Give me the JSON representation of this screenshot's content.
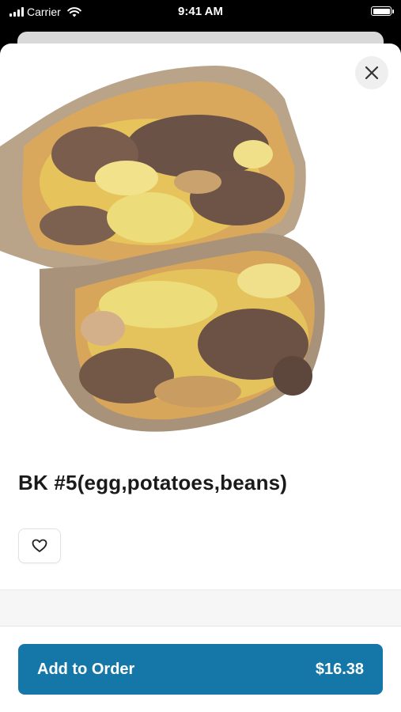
{
  "status_bar": {
    "carrier": "Carrier",
    "time": "9:41 AM"
  },
  "item": {
    "title": "BK #5(egg,potatoes,beans)",
    "image_alt": "Breakfast burrito cut in half showing egg, potatoes and beans"
  },
  "actions": {
    "close_icon": "close-icon",
    "favorite_icon": "heart-icon",
    "add_to_order_label": "Add to Order",
    "price": "$16.38"
  },
  "colors": {
    "accent": "#1577a8",
    "background": "#ffffff",
    "status_bar": "#000000"
  }
}
